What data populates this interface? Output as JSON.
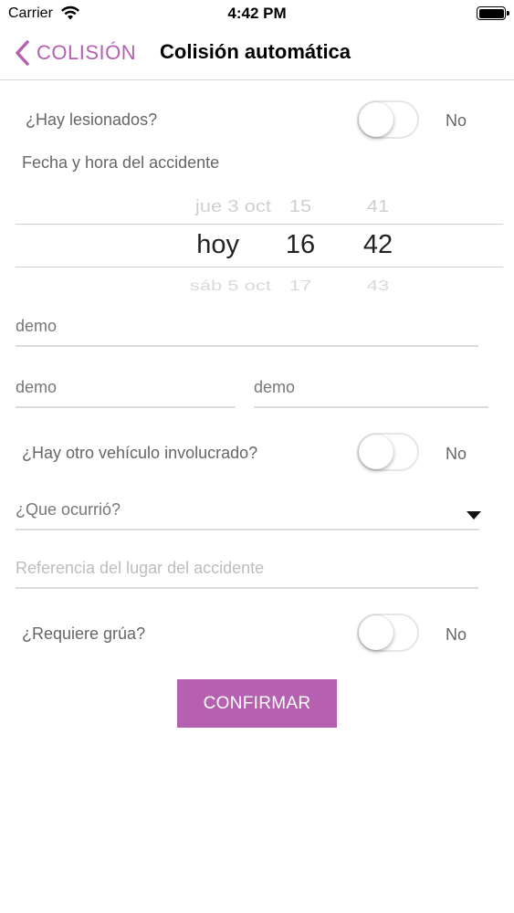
{
  "status_bar": {
    "carrier": "Carrier",
    "time": "4:42 PM",
    "wifi_icon": "wifi-icon",
    "battery_icon": "battery-icon"
  },
  "nav": {
    "back_label": "COLISIÓN",
    "back_icon": "chevron-left-icon",
    "title": "Colisión automática",
    "accent_color": "#b660b1"
  },
  "injured": {
    "label": "¿Hay lesionados?",
    "value": "No",
    "on": false
  },
  "datetime": {
    "label": "Fecha y hora del accidente",
    "picker": {
      "date": {
        "prev": "jue 3 oct",
        "selected": "hoy",
        "next": "sáb 5 oct"
      },
      "hour": {
        "prev": "15",
        "selected": "16",
        "next": "17"
      },
      "minute": {
        "prev": "41",
        "selected": "42",
        "next": "43"
      }
    }
  },
  "fields": {
    "field1": "demo",
    "field2": "demo",
    "field3": "demo"
  },
  "other_vehicle": {
    "label": "¿Hay otro vehículo involucrado?",
    "value": "No",
    "on": false
  },
  "what_happened": {
    "label": "¿Que ocurrió?",
    "icon": "triangle-down-icon"
  },
  "location_reference": {
    "placeholder": "Referencia del lugar del accidente"
  },
  "tow": {
    "label": "¿Requiere grúa?",
    "value": "No",
    "on": false
  },
  "confirm": {
    "label": "CONFIRMAR",
    "color": "#b660b1"
  }
}
